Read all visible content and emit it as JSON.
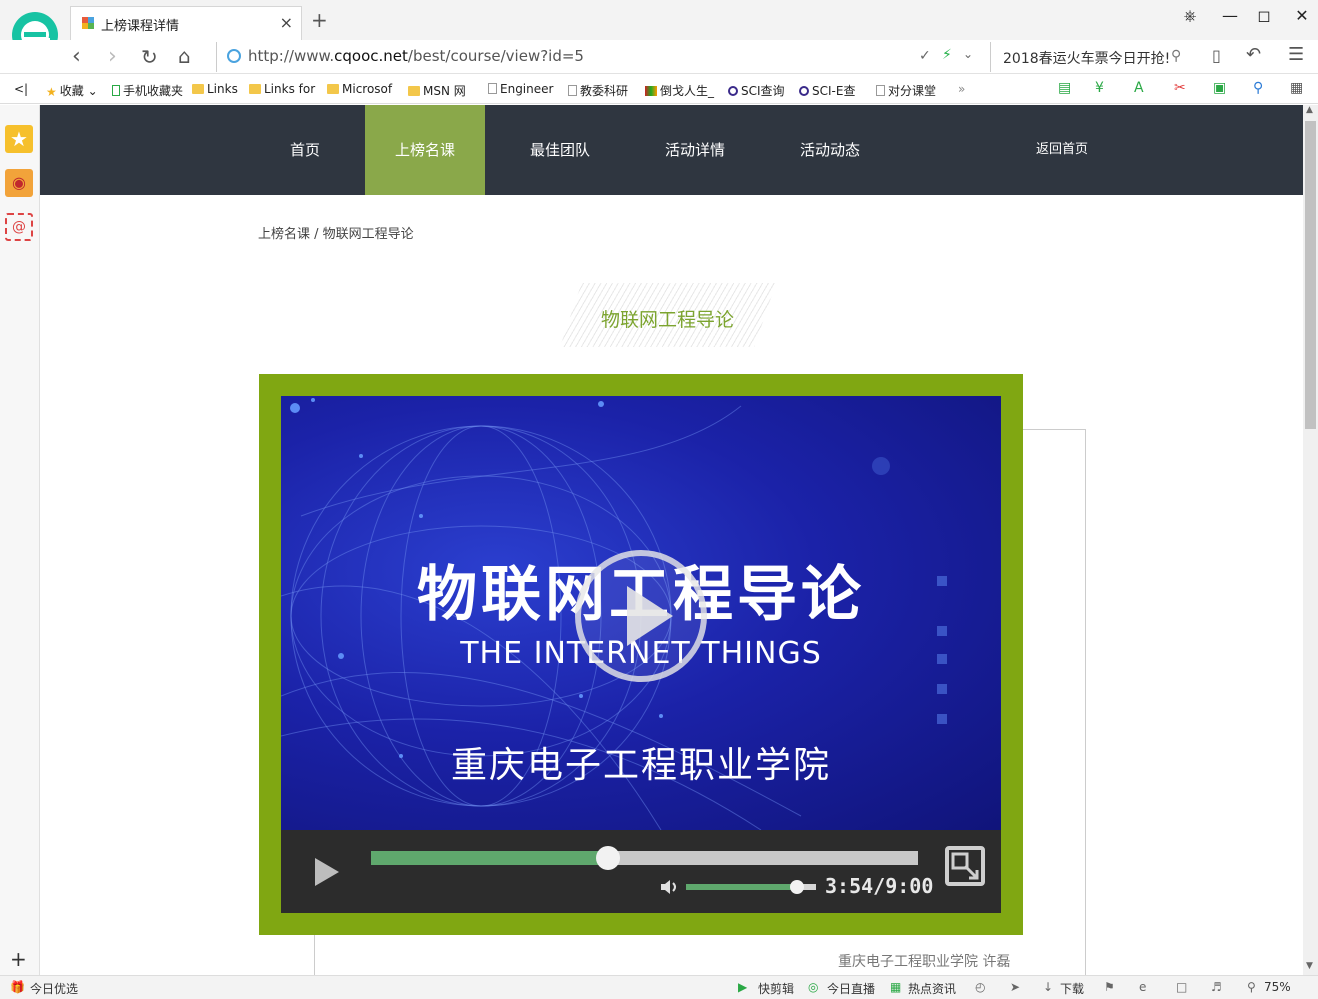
{
  "browser": {
    "tab_title": "上榜课程详情",
    "url_prefix": "http://www.",
    "url_domain": "cqooc.net",
    "url_path": "/best/course/view?id=5",
    "search_text": "2018春运火车票今日开抢!",
    "new_tab_glyph": "+",
    "close_glyph": "×"
  },
  "bookmarks": [
    {
      "label": "收藏"
    },
    {
      "label": "手机收藏夹"
    },
    {
      "label": "Links"
    },
    {
      "label": "Links for"
    },
    {
      "label": "Microsof"
    },
    {
      "label": "MSN 网"
    },
    {
      "label": "Engineer"
    },
    {
      "label": "教委科研"
    },
    {
      "label": "倒戈人生_"
    },
    {
      "label": "SCI查询"
    },
    {
      "label": "SCI-E查"
    },
    {
      "label": "对分课堂"
    },
    {
      "label": "»"
    }
  ],
  "site": {
    "nav": [
      {
        "label": "首页"
      },
      {
        "label": "上榜名课"
      },
      {
        "label": "最佳团队"
      },
      {
        "label": "活动详情"
      },
      {
        "label": "活动动态"
      }
    ],
    "back_home": "返回首页",
    "breadcrumb": "上榜名课 / 物联网工程导论",
    "course_title": "物联网工程导论",
    "credit": "重庆电子工程职业学院 许磊"
  },
  "video": {
    "title_cn": "物联网工程导论",
    "title_en": "THE INTERNET THINGS",
    "school": "重庆电子工程职业学院",
    "current_time": "3:54",
    "duration": "9:00",
    "time_display": "3:54/9:00",
    "progress_fraction": 0.4333,
    "volume_fraction": 0.85
  },
  "statusbar": {
    "left": "今日优选",
    "items": [
      "快剪辑",
      "今日直播",
      "热点资讯",
      "下载"
    ],
    "zoom": "75%"
  },
  "colors": {
    "nav_bg": "#2f3640",
    "nav_active": "#8aa84a",
    "accent_green": "#7ca42f",
    "frame_green": "#80a712",
    "progress_green": "#5fa86d"
  }
}
